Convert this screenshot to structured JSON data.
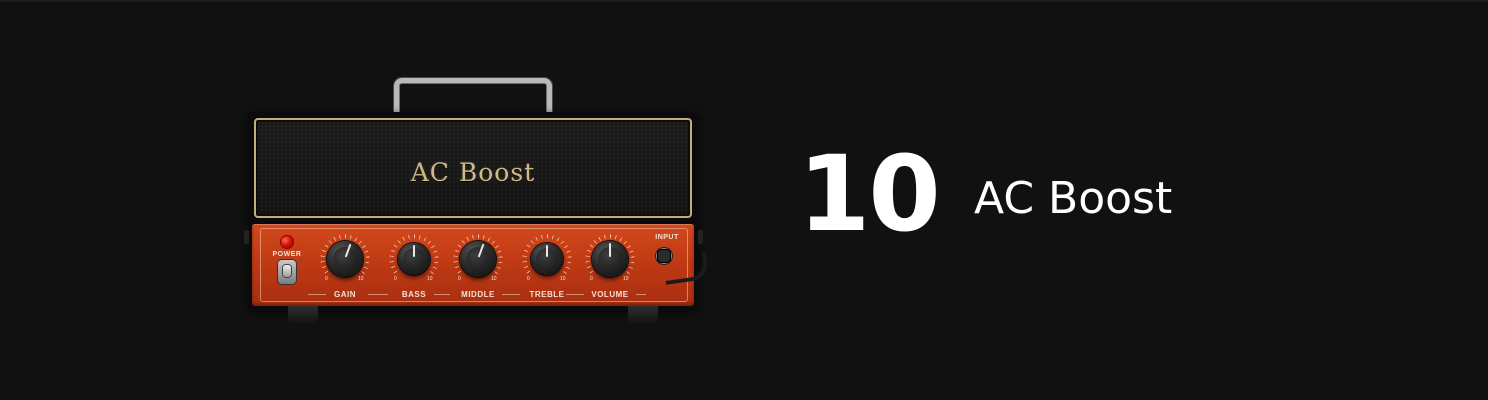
{
  "amp": {
    "logo": "AC Boost",
    "power_label": "POWER",
    "input_label": "INPUT",
    "scale_min": "0",
    "scale_max": "10",
    "knobs": [
      {
        "label": "GAIN",
        "value": 6
      },
      {
        "label": "BASS",
        "value": 5
      },
      {
        "label": "MIDDLE",
        "value": 6
      },
      {
        "label": "TREBLE",
        "value": 5
      },
      {
        "label": "VOLUME",
        "value": 5
      }
    ],
    "colors": {
      "faceplate": "#c03a14",
      "logo": "#cdb886",
      "led": "#e01010"
    }
  },
  "preset": {
    "number": "10",
    "name": "AC Boost"
  }
}
